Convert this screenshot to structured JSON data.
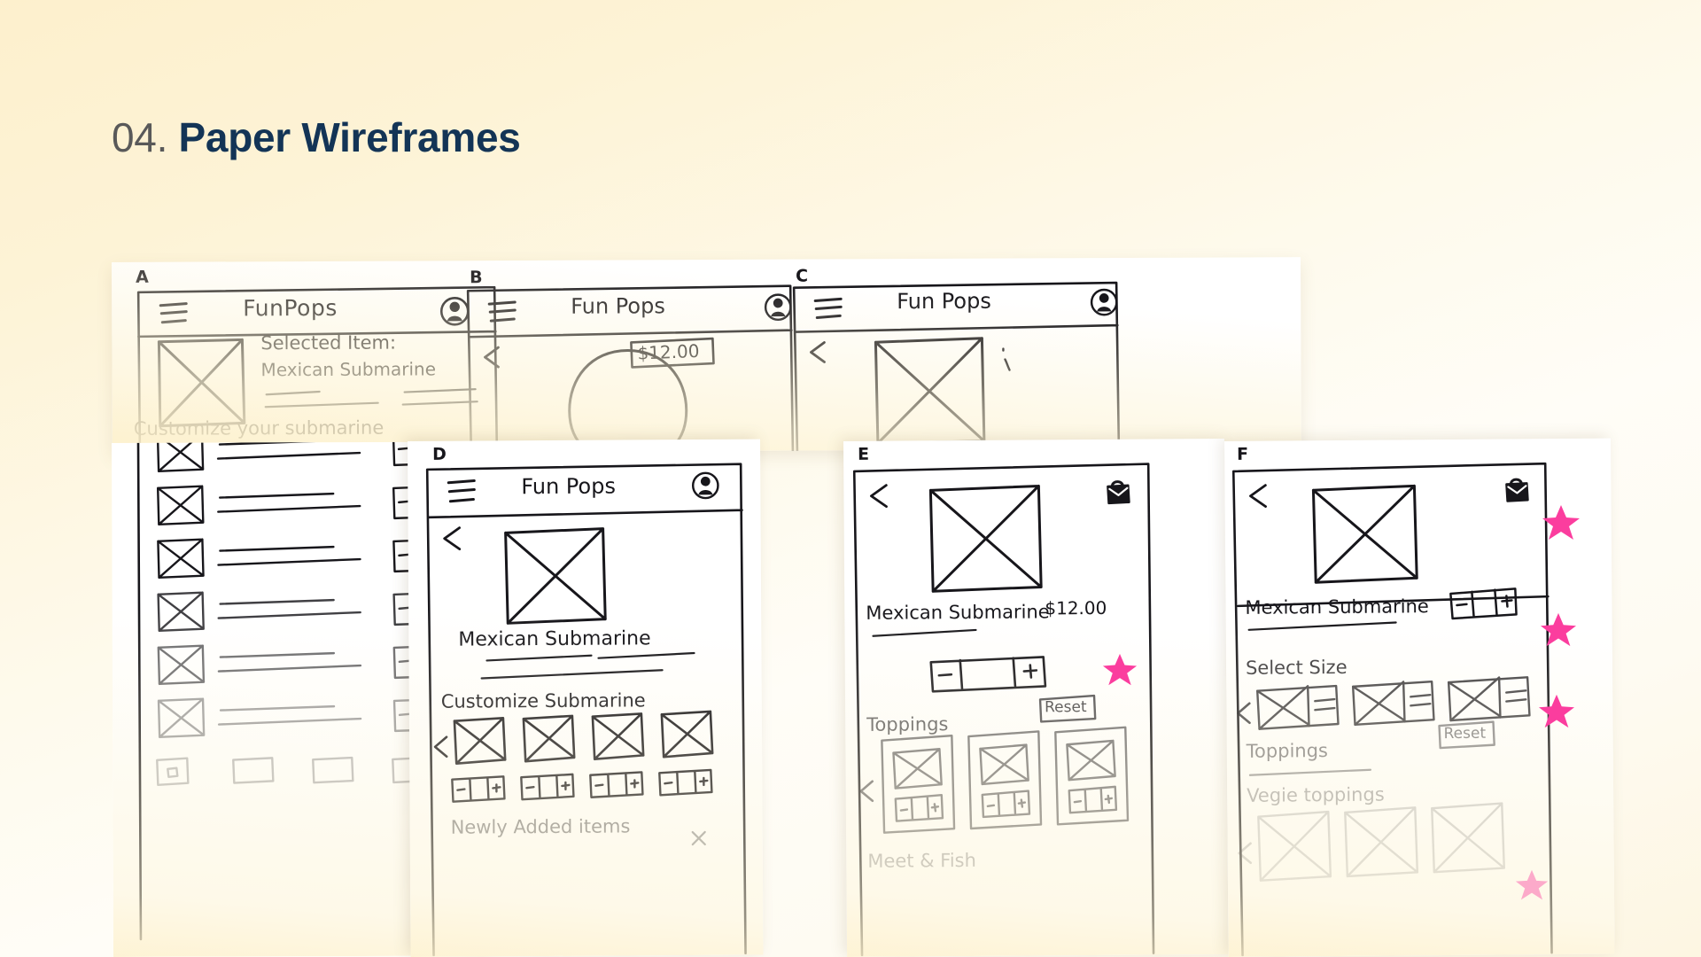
{
  "slide": {
    "section_number": "04.",
    "title": "Paper Wireframes",
    "background_color": "#fdf3d6",
    "title_color": "#133456",
    "number_color": "#595959",
    "accent_color": "#fb3d9e"
  },
  "wireframes": [
    {
      "id": "A",
      "label": "A",
      "screen_title": "FunPops",
      "icons": [
        "hamburger-menu-icon",
        "avatar-icon"
      ],
      "texts": [
        "Selected Item:",
        "Mexican  Submarine",
        "Customize  your  submarine"
      ],
      "stepper_label": "-",
      "rows": 6
    },
    {
      "id": "B",
      "label": "B",
      "screen_title": "Fun Pops",
      "icons": [
        "hamburger-menu-icon",
        "avatar-icon",
        "back-arrow-icon"
      ],
      "price": "$12.00"
    },
    {
      "id": "C",
      "label": "C",
      "screen_title": "Fun Pops",
      "icons": [
        "hamburger-menu-icon",
        "avatar-icon",
        "back-arrow-icon"
      ]
    },
    {
      "id": "D",
      "label": "D",
      "screen_title": "Fun Pops",
      "icons": [
        "hamburger-menu-icon",
        "avatar-icon",
        "back-arrow-icon"
      ],
      "texts": [
        "Mexican   Submarine",
        "Customize   Submarine",
        "Newly  Added  items"
      ],
      "steppers": [
        "- | +",
        "- | +",
        "- | +",
        "- | +"
      ]
    },
    {
      "id": "E",
      "label": "E",
      "icons": [
        "back-arrow-icon",
        "shopping-bag-icon"
      ],
      "texts": [
        "Mexican  Submarine",
        "Toppings",
        "Meet & Fish"
      ],
      "price": "$12.00",
      "stepper": "- | +",
      "reset_label": "Reset"
    },
    {
      "id": "F",
      "label": "F",
      "icons": [
        "back-arrow-icon",
        "shopping-bag-icon"
      ],
      "texts": [
        "Mexican  Submarine",
        "Select  Size",
        "Toppings",
        "Vegie  toppings"
      ],
      "stepper": "- | +",
      "reset_label": "Reset"
    }
  ],
  "annotations": {
    "star_marks": 5,
    "star_color": "#fb3d9e"
  }
}
